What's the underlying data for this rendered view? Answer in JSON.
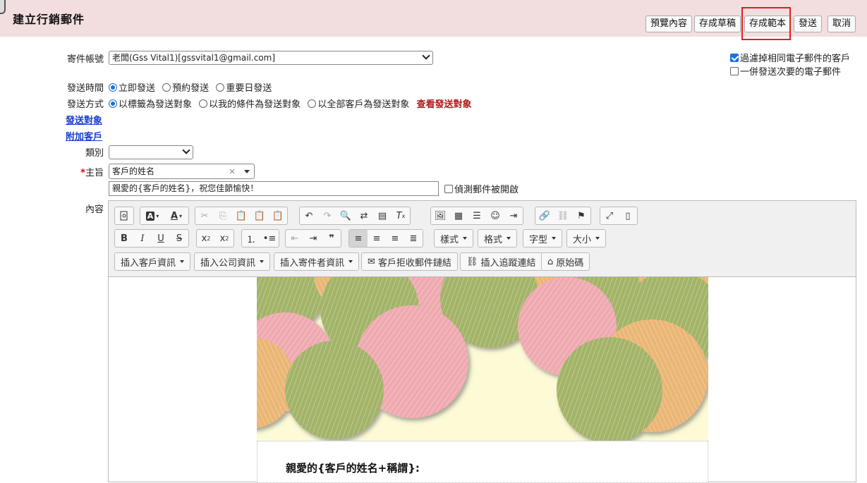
{
  "header": {
    "title": "建立行銷郵件",
    "buttons": {
      "preview": "預覽內容",
      "save_draft": "存成草稿",
      "save_template": "存成範本",
      "send": "發送",
      "cancel": "取消"
    }
  },
  "form": {
    "sender_label": "寄件帳號",
    "sender_value": "老闆(Gss Vital1)[gssvital1@gmail.com]",
    "filter_duplicate_label": "過濾掉相同電子郵件的客戶",
    "filter_duplicate_checked": true,
    "send_secondary_label": "一併發送次要的電子郵件",
    "send_secondary_checked": false,
    "send_time_label": "發送時間",
    "send_time_options": [
      "立即發送",
      "預約發送",
      "重要日發送"
    ],
    "send_time_selected": "立即發送",
    "send_method_label": "發送方式",
    "send_method_options": [
      "以標籤為發送對象",
      "以我的條件為發送對象",
      "以全部客戶為發送對象"
    ],
    "send_method_selected": "以標籤為發送對象",
    "view_targets_link": "查看發送對象",
    "send_targets_link": "發送對象",
    "attach_customer_link": "附加客戶",
    "category_label": "類別",
    "category_value": "",
    "subject_required_mark": "*",
    "subject_label": "主旨",
    "subject_token": "客戶的姓名",
    "subject_token_clear": "×",
    "subject_text": "親愛的{客戶的姓名}，祝您佳節愉快！",
    "track_open_label": "偵測郵件被開啟",
    "track_open_checked": false,
    "content_label": "內容"
  },
  "toolbar": {
    "style_label": "樣式",
    "format_label": "格式",
    "font_label": "字型",
    "size_label": "大小",
    "insert_customer": "插入客戶資訊",
    "insert_company": "插入公司資訊",
    "insert_sender": "插入寄件者資訊",
    "unsubscribe_link": "客戶拒收郵件鏈結",
    "tracking_link": "插入追蹤連結",
    "source": "原始碼",
    "bold": "B",
    "italic": "I",
    "underline": "U",
    "strike": "S"
  },
  "content": {
    "greeting": "親愛的{客戶的姓名+稱謂}:"
  },
  "colors": {
    "header_bg": "#f2dede",
    "link_blue": "#1a3fcf",
    "link_red": "#b01a1a",
    "highlight_red": "#e02020",
    "accent_blue": "#1a6fe0"
  }
}
